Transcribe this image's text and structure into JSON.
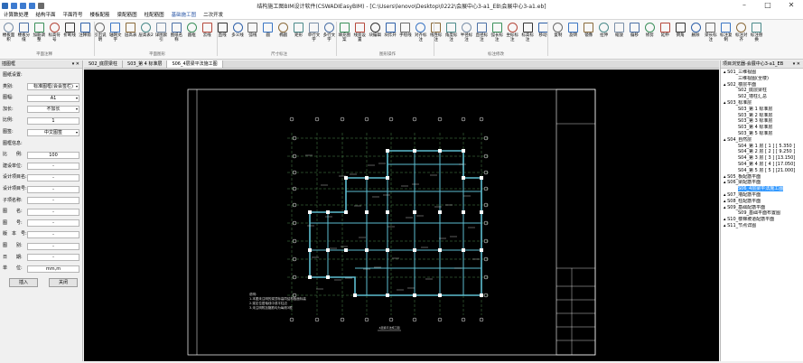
{
  "window": {
    "title": "结构施工图BIM设计软件(CSWADIEasyBIM) - [C:\\Users\\lenovo\\Desktop\\0222\\会展中心3-a1_EB\\会展中心3-a1.eb]"
  },
  "menu": [
    "计算数处理",
    "结构平面",
    "平面符号",
    "楼板配筋",
    "梁配筋图",
    "柱配筋图",
    "基础施工图",
    "二次开发"
  ],
  "ribbon": {
    "buttons": [
      "楼板面积",
      "楼板分缝",
      "加筋调整",
      "标高符号",
      "折断线",
      "注释箭",
      "引出说明",
      "轴网文字",
      "层高表",
      "层高表2",
      "详图索引",
      "图纸名称",
      "圆框",
      "云线",
      "直线",
      "多义线",
      "弧线",
      "圆",
      "椭圆",
      "矩形",
      "单行文字",
      "多行文字",
      "填充图案",
      "线宽设置",
      "块编辑",
      "块炸开",
      "手绘线",
      "对齐标注",
      "线性标注",
      "角度标注",
      "半径标注",
      "直径标注",
      "弧长标注",
      "坐标标注",
      "标高标注",
      "移动",
      "复制",
      "旋转",
      "镜像",
      "拉伸",
      "缩放",
      "偏移",
      "修剪",
      "延伸",
      "倒角",
      "删除",
      "梁长标注",
      "标注复制",
      "标注对齐",
      "标注替换"
    ],
    "groups": [
      "平面注释",
      "平面图形",
      "尺寸标注",
      "图形操作",
      "标注修改"
    ]
  },
  "left_panel": {
    "title": "插图框",
    "pin": "▾ ✕",
    "fields": [
      {
        "label": "图纸设置:",
        "value": ""
      },
      {
        "label": "类别:",
        "value": "标准图框(会会签栏)"
      },
      {
        "label": "图幅:",
        "value": "A1"
      },
      {
        "label": "加长:",
        "value": "不加长"
      },
      {
        "label": "比例:",
        "value": "1"
      },
      {
        "label": "图签:",
        "value": "中文图签"
      },
      {
        "label": "图框信息:",
        "value": ""
      },
      {
        "label": "比　　例:",
        "value": "100"
      },
      {
        "label": "建设单位:",
        "value": "-"
      },
      {
        "label": "设计项目名:",
        "value": "-"
      },
      {
        "label": "设计项目号:",
        "value": "-"
      },
      {
        "label": "子项名称:",
        "value": "-"
      },
      {
        "label": "图　　名:",
        "value": "-"
      },
      {
        "label": "图　　号:",
        "value": "-"
      },
      {
        "label": "版　本　号:",
        "value": "-"
      },
      {
        "label": "图　　别:",
        "value": "-"
      },
      {
        "label": "日　　期:",
        "value": "-"
      },
      {
        "label": "单　　位:",
        "value": "mm,m"
      }
    ],
    "insert_label": "插入",
    "close_label": "关闭"
  },
  "tabs": [
    "S02_底层梁柱",
    "S03_第 4 标准层",
    "S06_4层梁平法施工图"
  ],
  "right_panel": {
    "title": "项目浏览器-会展中心3-a1_EB",
    "pin": "▾ ✕",
    "tree": [
      {
        "text": "S01_三维视图",
        "indent": 0
      },
      {
        "text": "三维视图(全楼)",
        "indent": 2
      },
      {
        "text": "S02_楼层平面",
        "indent": 0
      },
      {
        "text": "S02_底层梁柱",
        "indent": 2
      },
      {
        "text": "S02_墙柱汇总",
        "indent": 2
      },
      {
        "text": "S03_标准层",
        "indent": 0
      },
      {
        "text": "S03_第 1 标准层",
        "indent": 2
      },
      {
        "text": "S03_第 2 标准层",
        "indent": 2
      },
      {
        "text": "S03_第 3 标准层",
        "indent": 2
      },
      {
        "text": "S03_第 4 标准层",
        "indent": 2
      },
      {
        "text": "S03_第 5 标准层",
        "indent": 2
      },
      {
        "text": "S04_自然层",
        "indent": 0
      },
      {
        "text": "S04_第 1 层 [ 1 ] [ 5.350 ]",
        "indent": 2
      },
      {
        "text": "S04_第 2 层 [ 2 ] [ 9.250 ]",
        "indent": 2
      },
      {
        "text": "S04_第 3 层 [ 3 ] [13.150]",
        "indent": 2
      },
      {
        "text": "S04_第 4 层 [ 4 ] [17.050]",
        "indent": 2
      },
      {
        "text": "S04_第 5 层 [ 5 ] [21.000]",
        "indent": 2
      },
      {
        "text": "S05_板配筋平面",
        "indent": 0
      },
      {
        "text": "S06_梁配筋平面",
        "indent": 0
      },
      {
        "text": "S06_4层梁平法施工图",
        "indent": 2,
        "selected": true
      },
      {
        "text": "S07_墙配筋平面",
        "indent": 0
      },
      {
        "text": "S08_柱配筋平面",
        "indent": 0
      },
      {
        "text": "S09_基础配筋平面",
        "indent": 0
      },
      {
        "text": "S09_基础平面布置图",
        "indent": 2
      },
      {
        "text": "S10_楼梯坡道配筋平面",
        "indent": 0
      },
      {
        "text": "S11_节点详图",
        "indent": 0
      }
    ]
  },
  "drawing": {
    "title_text": "4层梁平法施工图",
    "notes": "说明：\n1.本图未注明的梁顶标高同结构板面标高\n2.梁定位居轴线中或平柱边\n3.未注明附加箍筋均为每侧3根"
  },
  "colors": {
    "accent": "#3399ff",
    "canvas_bg": "#000000",
    "structure": "#5dbdcf",
    "grid": "#7fe07f",
    "frame": "#ffffff"
  }
}
